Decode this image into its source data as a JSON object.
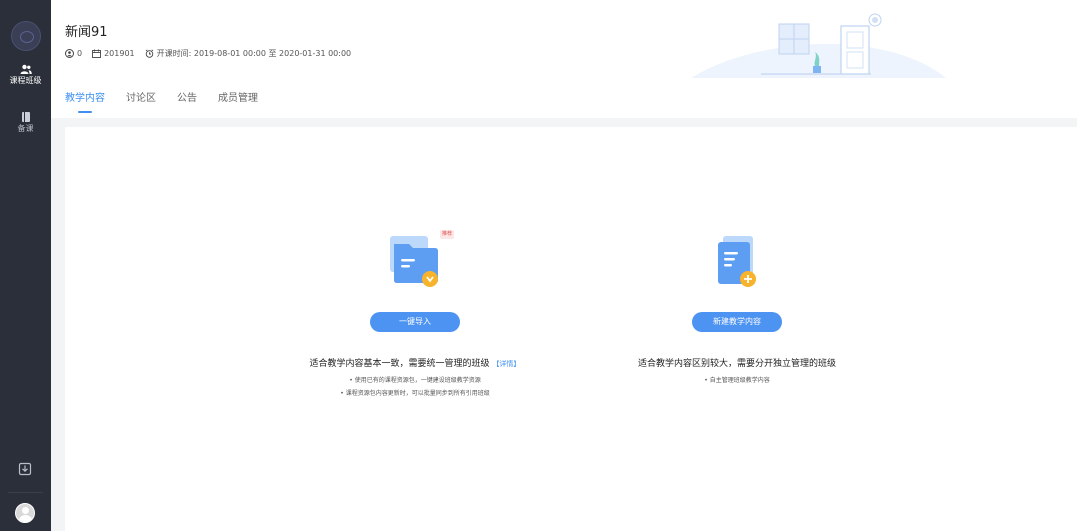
{
  "sidebar": {
    "items": [
      {
        "label": "课程班级",
        "icon": "users-icon",
        "active": true
      },
      {
        "label": "备课",
        "icon": "book-icon",
        "active": false
      }
    ],
    "bottom_icon": "download-icon"
  },
  "header": {
    "title": "新闻91",
    "meta": {
      "count": "0",
      "class_id": "201901",
      "schedule": "开课时间: 2019-08-01 00:00 至 2020-01-31 00:00"
    },
    "tabs": [
      {
        "label": "教学内容",
        "active": true
      },
      {
        "label": "讨论区",
        "active": false
      },
      {
        "label": "公告",
        "active": false
      },
      {
        "label": "成员管理",
        "active": false
      }
    ]
  },
  "options": [
    {
      "badge": "推荐",
      "button": "一键导入",
      "title": "适合教学内容基本一致，需要统一管理的班级",
      "link": "【详情】",
      "bullets": [
        "• 使用已有的课程资源包，一键建设班级教学资源",
        "• 课程资源包内容更新时，可以批量同步到所有引用班级"
      ]
    },
    {
      "button": "新建教学内容",
      "title": "适合教学内容区别较大，需要分开独立管理的班级",
      "bullets": [
        "• 自主管理班级教学内容"
      ]
    }
  ],
  "colors": {
    "accent": "#3e8ff0",
    "button": "#4c93f2",
    "sidebar": "#2b2f3a"
  }
}
